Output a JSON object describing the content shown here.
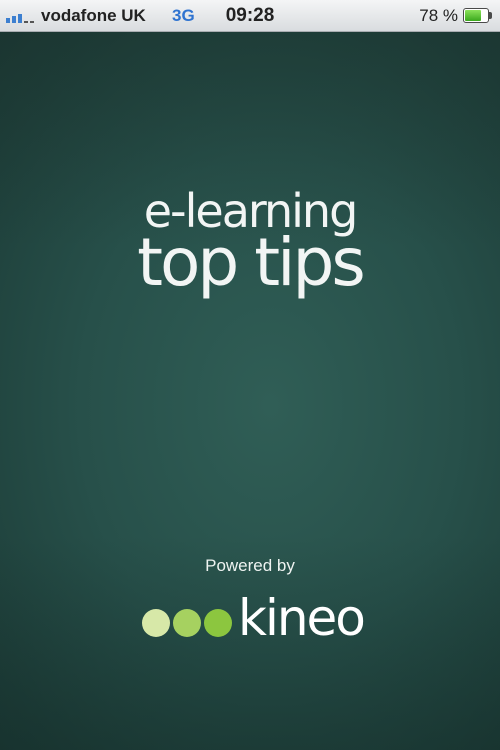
{
  "status_bar": {
    "carrier": "vodafone UK",
    "network_type": "3G",
    "time": "09:28",
    "battery_percent": "78 %",
    "battery_level": 0.78,
    "signal_bars_active": 3,
    "signal_bars_total": 5,
    "signal_icon": "signal-strength-icon",
    "battery_icon": "battery-icon",
    "colors": {
      "network": "#2f73d0",
      "signal": "#3c7fd0",
      "battery_fill": "#5ac63a"
    }
  },
  "splash": {
    "title_line_1": "e-learning",
    "title_line_2": "top tips",
    "powered_by": "Powered by",
    "logo": {
      "wordmark": "kineo",
      "dot_colors": [
        "#d7e8a8",
        "#a6d160",
        "#8cc63f"
      ]
    },
    "colors": {
      "background": "#27504a",
      "text": "#f2f5f4"
    }
  }
}
